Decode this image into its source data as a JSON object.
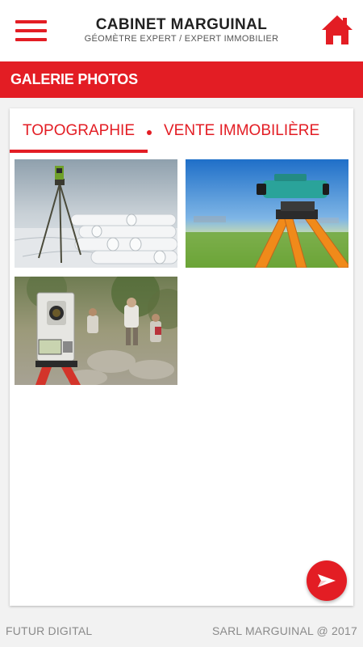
{
  "header": {
    "title": "CABINET MARGUINAL",
    "subtitle": "GÉOMÈTRE EXPERT / EXPERT IMMOBILIER",
    "menu_icon": "hamburger-menu-icon",
    "home_icon": "home-icon"
  },
  "section": {
    "title": "GALERIE PHOTOS"
  },
  "tabs": [
    {
      "label": "TOPOGRAPHIE",
      "active": true
    },
    {
      "label": "VENTE IMMOBILIÈRE",
      "active": false
    }
  ],
  "gallery": [
    {
      "subject": "theodolite-with-rolled-plans-photo"
    },
    {
      "subject": "level-on-tripod-photo"
    },
    {
      "subject": "total-station-field-photo"
    }
  ],
  "fab": {
    "icon": "send-icon"
  },
  "footer": {
    "left": "FUTUR DIGITAL",
    "right": "SARL MARGUINAL @ 2017"
  },
  "colors": {
    "accent": "#e31d24",
    "background": "#f2f2f2",
    "footer_text": "#8a8a8a"
  }
}
